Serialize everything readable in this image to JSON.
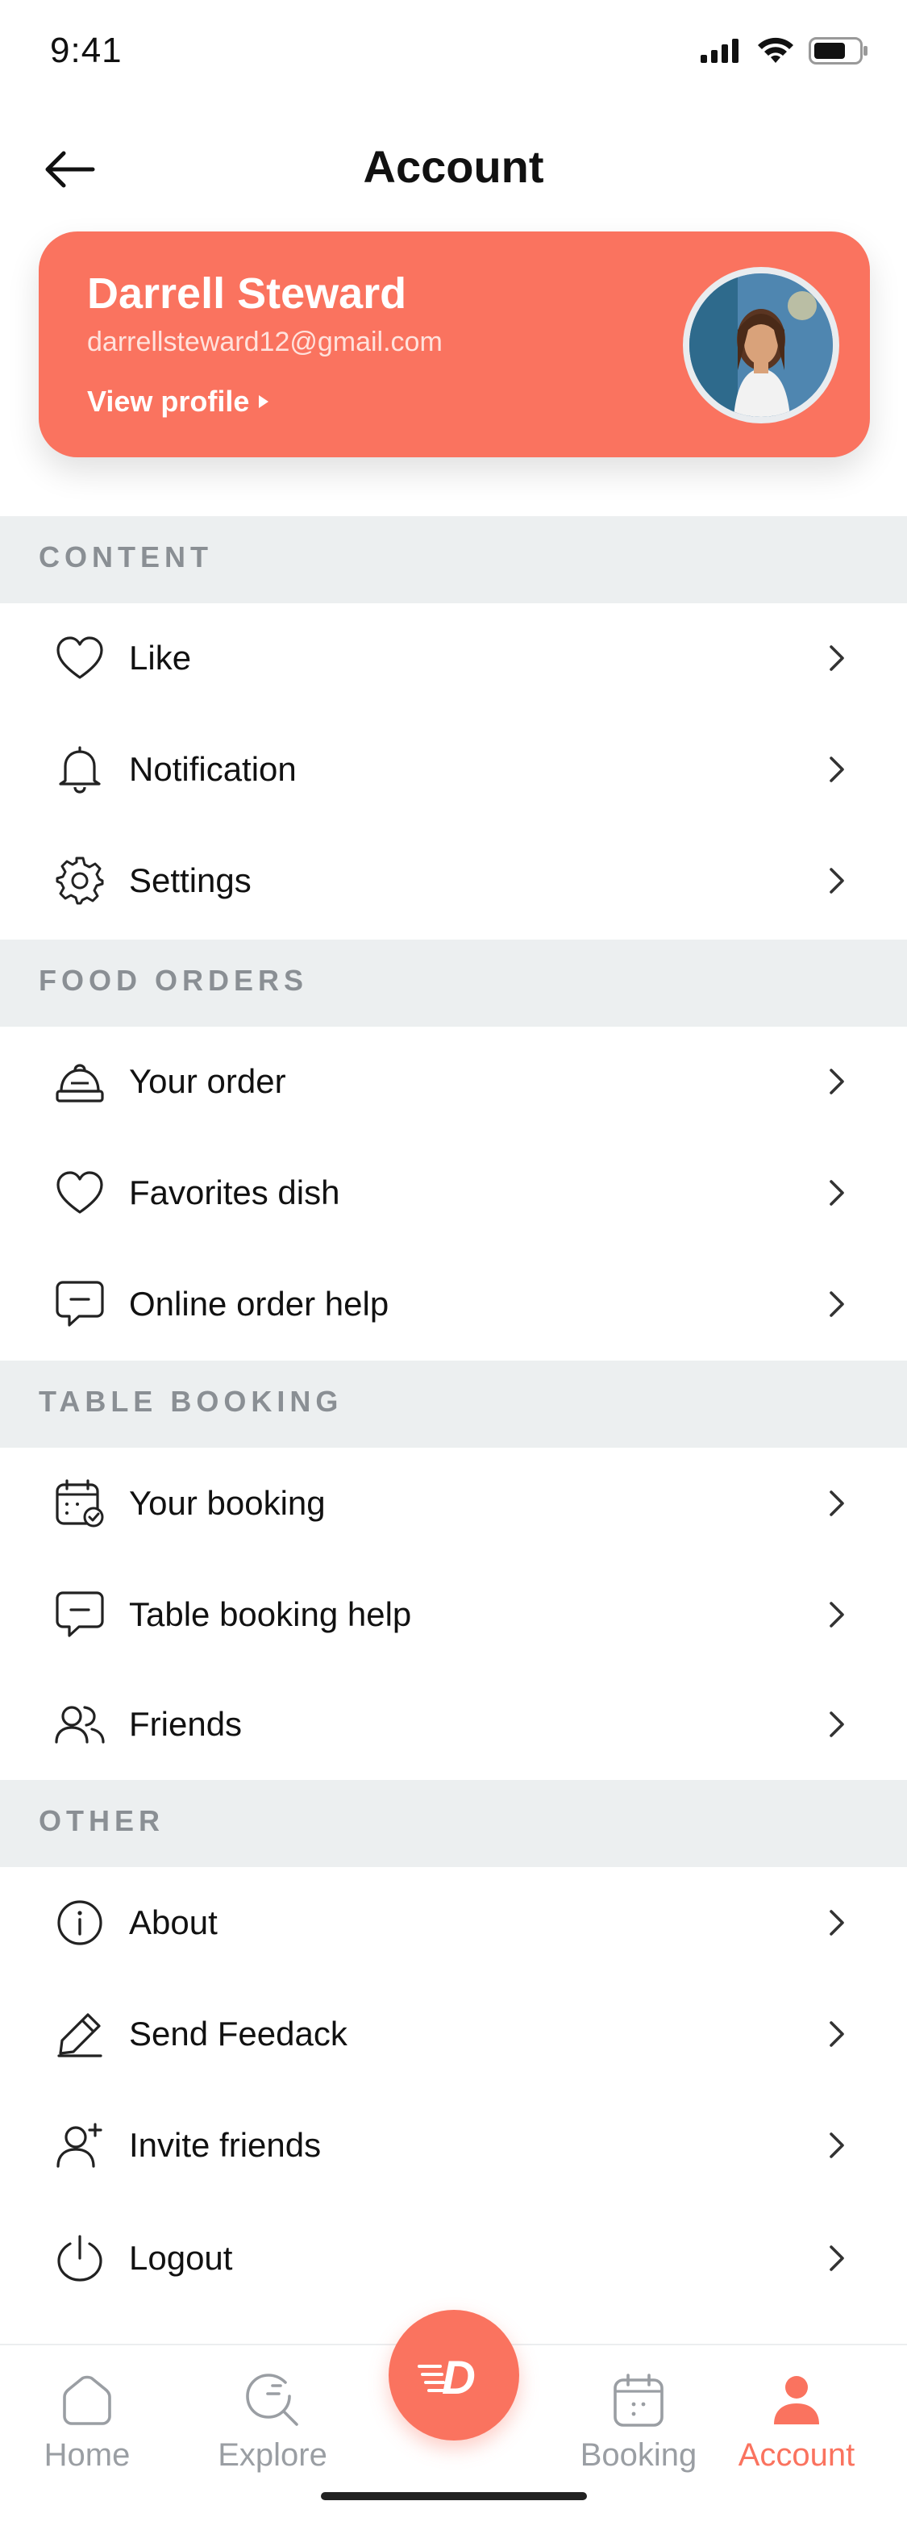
{
  "status_bar": {
    "time": "9:41"
  },
  "header": {
    "title": "Account"
  },
  "profile": {
    "name": "Darrell Steward",
    "email": "darrellsteward12@gmail.com",
    "view_profile_label": "View profile"
  },
  "sections": {
    "content": {
      "title": "CONTENT",
      "items": [
        {
          "label": "Like",
          "icon": "heart-icon"
        },
        {
          "label": "Notification",
          "icon": "bell-icon"
        },
        {
          "label": "Settings",
          "icon": "gear-icon"
        }
      ]
    },
    "food_orders": {
      "title": "FOOD ORDERS",
      "items": [
        {
          "label": "Your order",
          "icon": "cloche-icon"
        },
        {
          "label": "Favorites dish",
          "icon": "heart-icon"
        },
        {
          "label": "Online order help",
          "icon": "chat-icon"
        }
      ]
    },
    "table_booking": {
      "title": "TABLE BOOKING",
      "items": [
        {
          "label": "Your booking",
          "icon": "calendar-check-icon"
        },
        {
          "label": "Table booking help",
          "icon": "chat-icon"
        },
        {
          "label": "Friends",
          "icon": "users-icon"
        }
      ]
    },
    "other": {
      "title": "OTHER",
      "items": [
        {
          "label": "About",
          "icon": "info-icon"
        },
        {
          "label": "Send Feedack",
          "icon": "pencil-icon"
        },
        {
          "label": "Invite friends",
          "icon": "user-plus-icon"
        },
        {
          "label": "Logout",
          "icon": "power-icon"
        }
      ]
    }
  },
  "bottom_nav": {
    "items": [
      {
        "label": "Home",
        "icon": "home-icon"
      },
      {
        "label": "Explore",
        "icon": "explore-icon"
      },
      {
        "label": "Booking",
        "icon": "calendar-icon"
      },
      {
        "label": "Account",
        "icon": "user-icon"
      }
    ],
    "active": "Account",
    "center_logo": "D"
  },
  "colors": {
    "accent": "#fa735f",
    "section_bg": "#eceff0",
    "section_text": "#8a8f94",
    "inactive_nav": "#9a9ea3"
  }
}
